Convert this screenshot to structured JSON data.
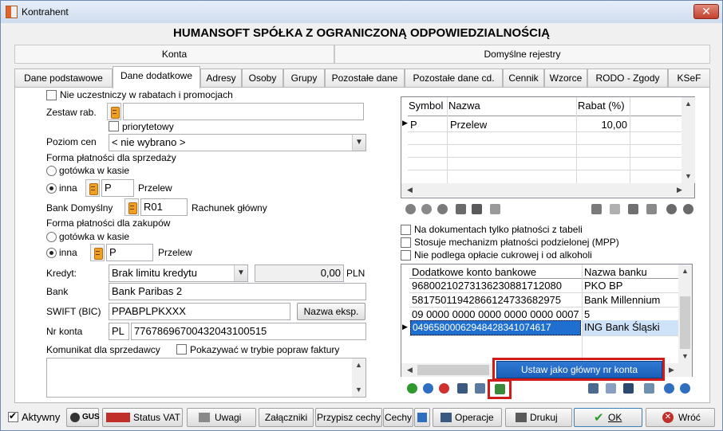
{
  "window": {
    "title": "Kontrahent",
    "close": "✕"
  },
  "heading": "HUMANSOFT SPÓŁKA Z OGRANICZONĄ ODPOWIEDZIALNOŚCIĄ",
  "sections": {
    "konta": "Konta",
    "rejestry": "Domyślne rejestry"
  },
  "tabs": [
    "Dane podstawowe",
    "Dane dodatkowe",
    "Adresy",
    "Osoby",
    "Grupy",
    "Pozostałe dane",
    "Pozostałe dane cd.",
    "Cennik",
    "Wzorce",
    "RODO - Zgody",
    "KSeF"
  ],
  "left": {
    "nie_uczestniczy": "Nie uczestniczy w rabatach i promocjach",
    "zestaw_rab_label": "Zestaw rab.",
    "zestaw_rab_value": "",
    "priorytetowy": "priorytetowy",
    "poziom_cen_label": "Poziom cen",
    "poziom_cen_value": "< nie wybrano >",
    "forma_sprzedazy": "Forma płatności dla sprzedaży",
    "gotowka1": "gotówka w kasie",
    "inna1": "inna",
    "inna1_code": "P",
    "inna1_name": "Przelew",
    "bank_domyslny_label": "Bank Domyślny",
    "bank_domyslny_code": "R01",
    "bank_domyslny_name": "Rachunek główny",
    "forma_zakupow": "Forma płatności dla zakupów",
    "gotowka2": "gotówka w kasie",
    "inna2": "inna",
    "inna2_code": "P",
    "inna2_name": "Przelew",
    "kredyt_label": "Kredyt:",
    "kredyt_value": "Brak limitu kredytu",
    "kredyt_amount": "0,00",
    "kredyt_currency": "PLN",
    "bank_label": "Bank",
    "bank_value": "Bank Paribas 2",
    "swift_label": "SWIFT (BIC)",
    "swift_value": "PPABPLPKXXX",
    "nazwa_eksp": "Nazwa eksp.",
    "nr_konta_label": "Nr konta",
    "nr_konta_country": "PL",
    "nr_konta_value": "77678696700432043100515",
    "komunikat_label": "Komunikat dla sprzedawcy",
    "pokazywac": "Pokazywać w trybie popraw faktury",
    "komunikat_value": ""
  },
  "rabat_grid": {
    "headers": [
      "Symbol",
      "Nazwa",
      "Rabat (%)"
    ],
    "rows": [
      [
        "P",
        "Przelew",
        "10,00"
      ]
    ]
  },
  "right_checks": {
    "na_dokumentach": "Na dokumentach tylko płatności z tabeli",
    "stosuje": "Stosuje mechanizm płatności podzielonej (MPP)",
    "nie_podlega": "Nie podlega opłacie cukrowej i od alkoholi"
  },
  "bank_grid": {
    "headers": [
      "Dodatkowe konto bankowe",
      "Nazwa banku"
    ],
    "rows": [
      [
        "96800210273136230881712080",
        "PKO BP"
      ],
      [
        "58175011942866124733682975",
        "Bank Millennium"
      ],
      [
        "09 0000 0000 0000 0000 0000 0007",
        "5"
      ],
      [
        "04965800062948428341074617",
        "ING Bank Śląski"
      ]
    ]
  },
  "context_menu": "Ustaw jako główny nr konta",
  "bottom": {
    "aktywny": "Aktywny",
    "gus": "GUS",
    "status_vat": "Status VAT",
    "uwagi": "Uwagi",
    "zalaczniki": "Załączniki",
    "przypisz_cechy": "Przypisz cechy",
    "cechy": "Cechy",
    "operacje": "Operacje",
    "drukuj": "Drukuj",
    "ok": "OK",
    "wroc": "Wróć"
  },
  "colors": {
    "accent": "#1a5fb8",
    "highlight": "#d11a1a",
    "ok_green": "#2e9a2e",
    "cancel_red": "#c0302a"
  }
}
